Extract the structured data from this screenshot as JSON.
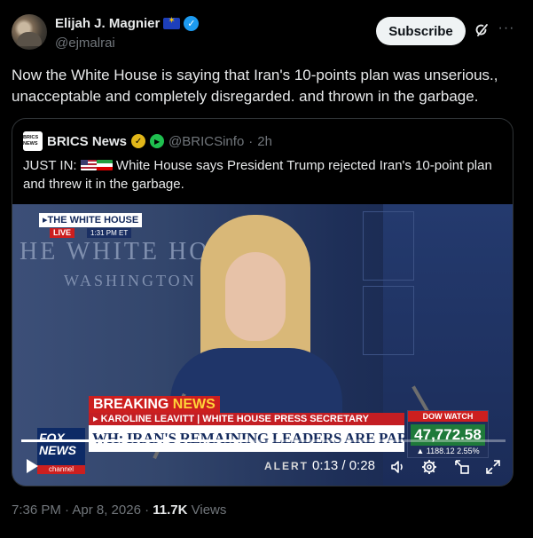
{
  "author": {
    "name": "Elijah J. Magnier",
    "handle": "@ejmalrai",
    "badge_icon": "eu-flag-icon",
    "verified_icon": "verified-badge-icon",
    "verified_color": "#1d9bf0"
  },
  "actions": {
    "subscribe_label": "Subscribe",
    "more_icon": "more-icon",
    "grok_icon": "grok-icon"
  },
  "post": {
    "text": "Now the White House is saying that Iran's 10-points plan was unserious., unacceptable and completely disregarded. and thrown in the garbage."
  },
  "quote": {
    "name": "BRICS News",
    "logo_text": "BRICS NEWS",
    "handle": "@BRICSinfo",
    "time": "2h",
    "prefix": "JUST IN:",
    "text": "White House says President Trump rejected Iran's 10-point plan and threw it in the garbage.",
    "gold_check_color": "#e2b719"
  },
  "video": {
    "bg_text": "HE WHITE HO",
    "bg_subtext": "WASHINGTON",
    "tag_title": "THE WHITE HOUSE",
    "tag_live": "LIVE",
    "tag_time": "1:31 PM ET",
    "breaking_label": "BREAKING",
    "breaking_news": "NEWS",
    "lower_name": "KAROLINE LEAVITT | WHITE HOUSE PRESS SECRETARY",
    "lower_headline": "WH: IRAN'S REMAINING LEADERS ARE PARALYZED IN FEAR",
    "dow_title": "DOW WATCH",
    "dow_value": "47,772.58",
    "dow_change": "▲ 1188.12  2.55%",
    "network": "FOX NEWS",
    "network_sub": "channel",
    "alert_text": "ALERT",
    "current_time": "0:13",
    "duration": "0:28",
    "progress": 0.464
  },
  "footer": {
    "timestamp": "7:36 PM · Apr 8, 2026 · ",
    "views_count": "11.7K",
    "views_label": " Views"
  }
}
